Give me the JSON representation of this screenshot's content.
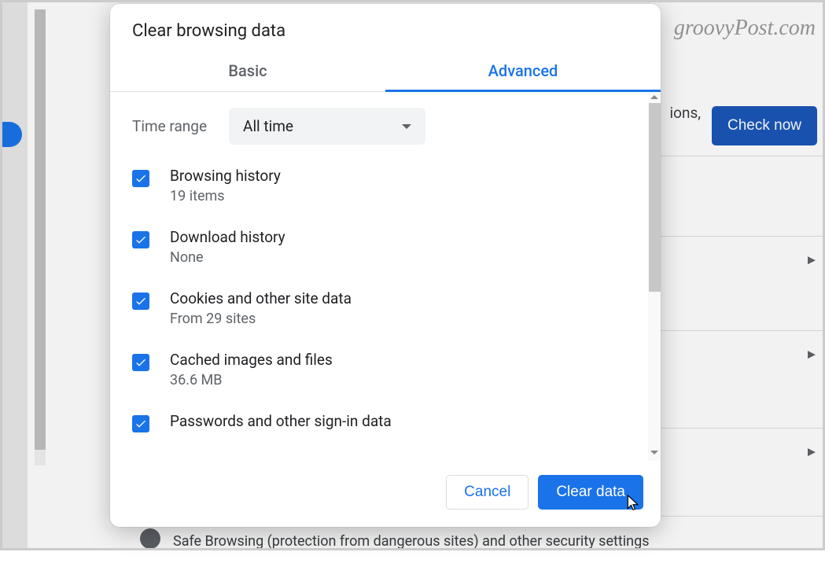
{
  "background": {
    "watermark": "groovyPost.com",
    "check_now_label": "Check now",
    "extensions_partial": "ions,",
    "safe_browsing_text": "Safe Browsing (protection from dangerous sites) and other security settings"
  },
  "modal": {
    "title": "Clear browsing data",
    "tabs": {
      "basic": "Basic",
      "advanced": "Advanced"
    },
    "time_range": {
      "label": "Time range",
      "value": "All time"
    },
    "items": [
      {
        "title": "Browsing history",
        "sub": "19 items",
        "checked": true
      },
      {
        "title": "Download history",
        "sub": "None",
        "checked": true
      },
      {
        "title": "Cookies and other site data",
        "sub": "From 29 sites",
        "checked": true
      },
      {
        "title": "Cached images and files",
        "sub": "36.6 MB",
        "checked": true
      },
      {
        "title": "Passwords and other sign-in data",
        "sub": "",
        "checked": true
      }
    ],
    "buttons": {
      "cancel": "Cancel",
      "clear": "Clear data"
    }
  }
}
